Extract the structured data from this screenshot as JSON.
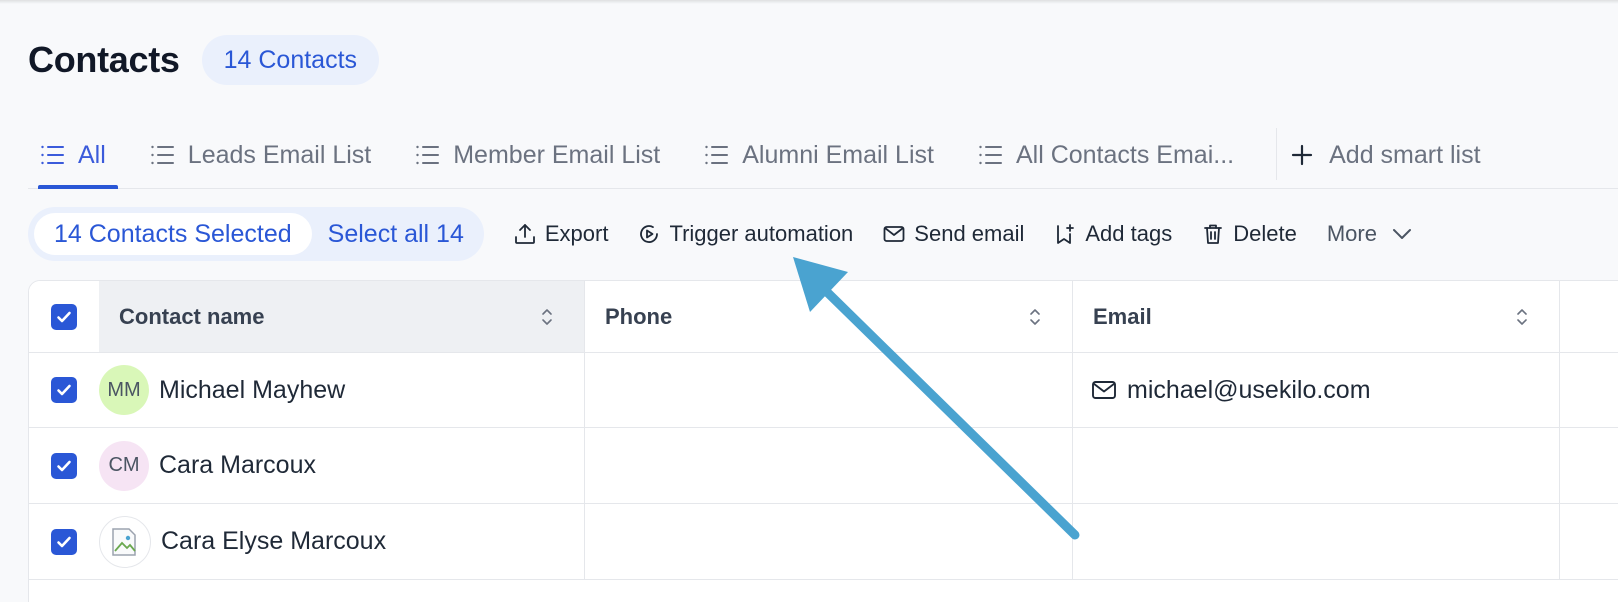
{
  "header": {
    "title": "Contacts",
    "count_badge": "14 Contacts"
  },
  "tabs": [
    {
      "label": "All",
      "icon": "list-icon",
      "active": true
    },
    {
      "label": "Leads Email List",
      "icon": "list-icon"
    },
    {
      "label": "Member Email List",
      "icon": "list-icon"
    },
    {
      "label": "Alumni Email List",
      "icon": "list-icon"
    },
    {
      "label": "All Contacts Emai...",
      "icon": "list-icon"
    }
  ],
  "add_smart_list": "Add smart list",
  "toolbar": {
    "selected_label": "14 Contacts Selected",
    "select_all_label": "Select all 14",
    "export": "Export",
    "trigger_automation": "Trigger automation",
    "send_email": "Send email",
    "add_tags": "Add tags",
    "delete": "Delete",
    "more": "More"
  },
  "table": {
    "columns": [
      "Contact name",
      "Phone",
      "Email"
    ],
    "rows": [
      {
        "initials": "MM",
        "name": "Michael Mayhew",
        "phone": "",
        "email": "michael@usekilo.com",
        "avatar_color": "#d9f7b8"
      },
      {
        "initials": "CM",
        "name": "Cara Marcoux",
        "phone": "",
        "email": "",
        "avatar_color": "#f6e4f4"
      },
      {
        "initials": "",
        "name": "Cara Elyse Marcoux",
        "phone": "",
        "email": "",
        "avatar_image": "broken-image-icon"
      }
    ]
  },
  "colors": {
    "accent": "#2a57d6",
    "annotation_arrow": "#4aa3d0"
  }
}
